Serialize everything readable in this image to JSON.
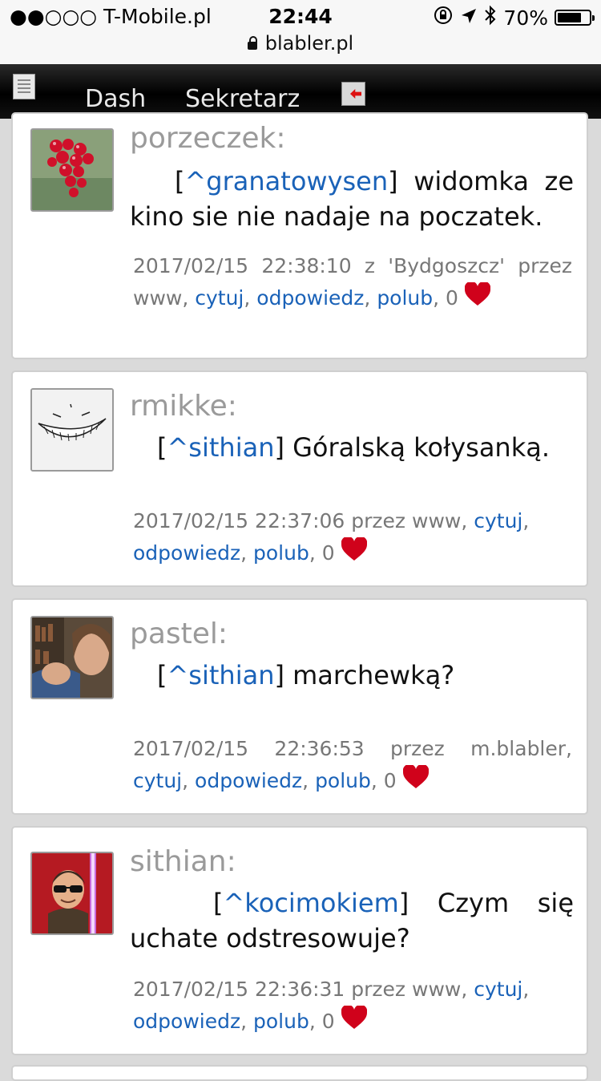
{
  "status_bar": {
    "carrier": "●●○○○ T-Mobile.pl",
    "time": "22:44",
    "battery": "70%",
    "url": "blabler.pl"
  },
  "nav": {
    "items": [
      "Dash",
      "Sekretarz"
    ]
  },
  "posts": [
    {
      "author": "porzeczek:",
      "mention": "^granatowysen",
      "text": "widomka ze kino sie nie nadaje na poczatek.",
      "datetime": "2017/02/15 22:38:10",
      "source": "z 'Bydgoszcz' przez www,",
      "cytuj": "cytuj",
      "odpowiedz": "odpowiedz",
      "polub": "polub",
      "likes": "0"
    },
    {
      "author": "rmikke:",
      "mention": "^sithian",
      "text": "Góralską kołysanką.",
      "datetime": "2017/02/15 22:37:06",
      "source": "przez www,",
      "cytuj": "cytuj",
      "odpowiedz": "odpowiedz",
      "polub": "polub",
      "likes": "0"
    },
    {
      "author": "pastel:",
      "mention": "^sithian",
      "text": "marchewką?",
      "datetime": "2017/02/15 22:36:53",
      "source": "przez m.blabler,",
      "cytuj": "cytuj",
      "odpowiedz": "odpowiedz",
      "polub": "polub",
      "likes": "0"
    },
    {
      "author": "sithian:",
      "mention": "^kocimokiem",
      "text": "Czym się uchate odstresowuje?",
      "datetime": "2017/02/15 22:36:31",
      "source": "przez www,",
      "cytuj": "cytuj",
      "odpowiedz": "odpowiedz",
      "polub": "polub",
      "likes": "0"
    }
  ],
  "colors": {
    "link": "#1a62b8",
    "heart": "#d0021b",
    "author": "#9a9a9a",
    "background": "#dadada"
  }
}
